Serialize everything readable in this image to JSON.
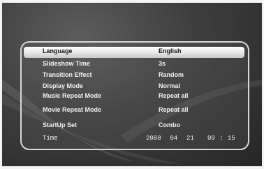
{
  "menu": {
    "items": [
      {
        "label": "Language",
        "value": "English"
      },
      {
        "label": "Slideshow Time",
        "value": "3s"
      },
      {
        "label": "Transition Effect",
        "value": "Random"
      },
      {
        "label": "Display Mode",
        "value": "Normal"
      },
      {
        "label": "Music Repeat Mode",
        "value": "Repeat all"
      },
      {
        "label": "Movie Repeat Mode",
        "value": "Repeat all"
      },
      {
        "label": "StartUp Set",
        "value": "Combo"
      },
      {
        "label": "Time",
        "value": "2008  04  21   09 : 15"
      }
    ],
    "selected_index": 0
  }
}
